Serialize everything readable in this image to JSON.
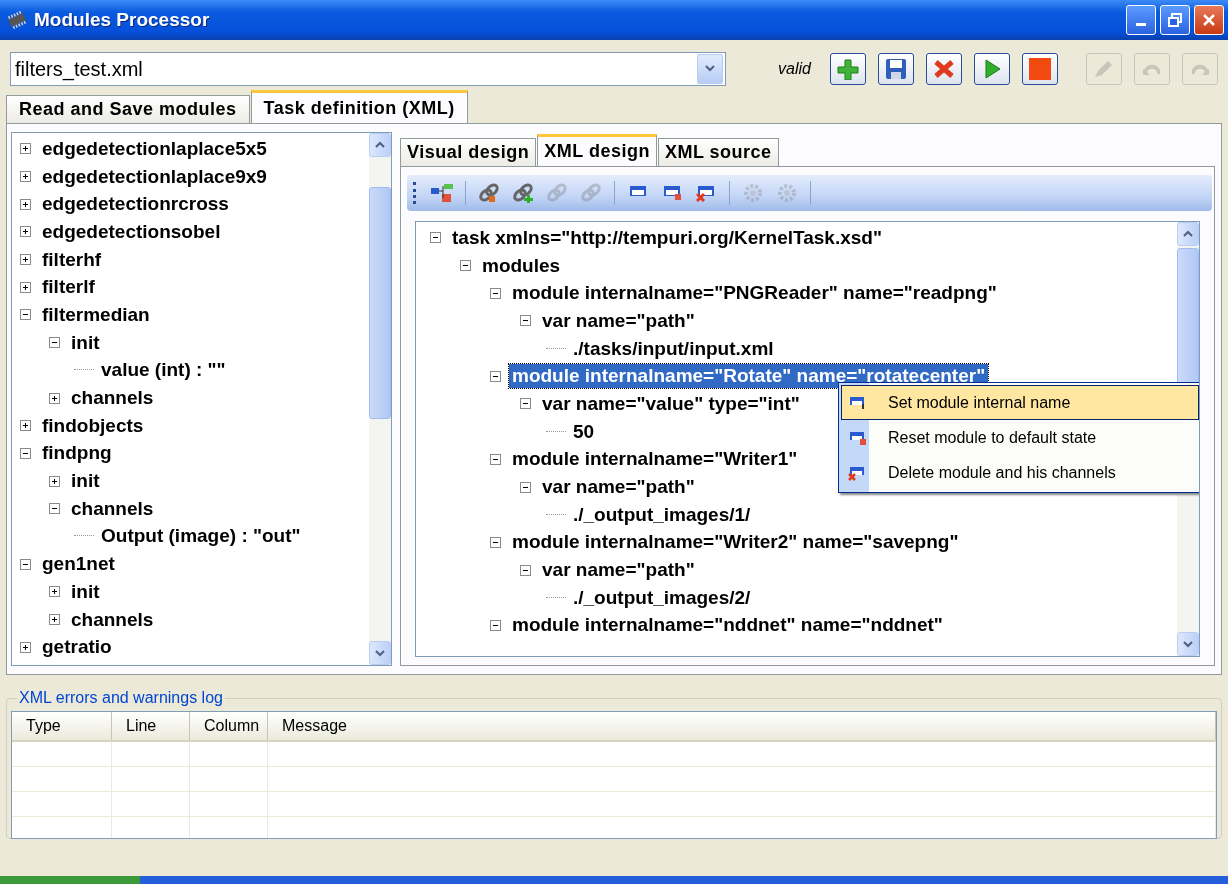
{
  "window": {
    "title": "Modules Processor"
  },
  "file_combo": {
    "value": "filters_test.xml"
  },
  "validation": "valid",
  "toolbar": [
    {
      "kind": "add",
      "disabled": false
    },
    {
      "kind": "save",
      "disabled": false
    },
    {
      "kind": "delete",
      "disabled": false
    },
    {
      "kind": "run",
      "disabled": false
    },
    {
      "kind": "stop",
      "disabled": false
    },
    {
      "kind": "edit",
      "disabled": true
    },
    {
      "kind": "undo",
      "disabled": true
    },
    {
      "kind": "redo",
      "disabled": true
    }
  ],
  "tabs": [
    {
      "label": "Read and Save modules",
      "selected": false
    },
    {
      "label": "Task definition (XML)",
      "selected": true
    }
  ],
  "module_tree": {
    "items": [
      {
        "label": "edgedetectionlaplace5x5",
        "expanded": false
      },
      {
        "label": "edgedetectionlaplace9x9",
        "expanded": false
      },
      {
        "label": "edgedetectionrcross",
        "expanded": false
      },
      {
        "label": "edgedetectionsobel",
        "expanded": false
      },
      {
        "label": "filterhf",
        "expanded": false
      },
      {
        "label": "filterlf",
        "expanded": false
      },
      {
        "label": "filtermedian",
        "expanded": true,
        "children": [
          {
            "label": "init",
            "expanded": true,
            "children": [
              {
                "label": "value (int) : \"\""
              }
            ]
          },
          {
            "label": "channels",
            "expanded": false
          }
        ]
      },
      {
        "label": "findobjects",
        "expanded": false
      },
      {
        "label": "findpng",
        "expanded": true,
        "children": [
          {
            "label": "init",
            "expanded": false
          },
          {
            "label": "channels",
            "expanded": true,
            "children": [
              {
                "label": "Output (image) : \"out\""
              }
            ]
          }
        ]
      },
      {
        "label": "gen1net",
        "expanded": true,
        "children": [
          {
            "label": "init",
            "expanded": false
          },
          {
            "label": "channels",
            "expanded": false
          }
        ]
      },
      {
        "label": "getratio",
        "expanded": false
      }
    ]
  },
  "sub_tabs": [
    {
      "label": "Visual design",
      "selected": false
    },
    {
      "label": "XML design",
      "selected": true
    },
    {
      "label": "XML source",
      "selected": false
    }
  ],
  "xml_toolbar": [
    {
      "kind": "tree",
      "disabled": false
    },
    {
      "kind": "link-edit",
      "disabled": false
    },
    {
      "kind": "link-add",
      "disabled": false
    },
    {
      "kind": "link",
      "disabled": true
    },
    {
      "kind": "link",
      "disabled": true
    },
    {
      "kind": "window",
      "disabled": false
    },
    {
      "kind": "window-reset",
      "disabled": false
    },
    {
      "kind": "window-delete",
      "disabled": false
    },
    {
      "kind": "gear",
      "disabled": true
    },
    {
      "kind": "gear",
      "disabled": true
    }
  ],
  "xml_tree": {
    "items": [
      {
        "label": "task xmlns=\"http://tempuri.org/KernelTask.xsd\"",
        "expanded": true,
        "selected": false,
        "children": [
          {
            "label": "modules",
            "expanded": true,
            "selected": false,
            "children": [
              {
                "label": "module internalname=\"PNGReader\" name=\"readpng\"",
                "expanded": true,
                "selected": false,
                "children": [
                  {
                    "label": "var name=\"path\"",
                    "expanded": true,
                    "selected": false,
                    "children": [
                      {
                        "label": "./tasks/input/input.xml",
                        "selected": false
                      }
                    ]
                  }
                ]
              },
              {
                "label": "module internalname=\"Rotate\" name=\"rotatecenter\"",
                "expanded": true,
                "selected": true,
                "children": [
                  {
                    "label": "var name=\"value\" type=\"int\"",
                    "expanded": true,
                    "selected": false,
                    "children": [
                      {
                        "label": "50",
                        "selected": false
                      }
                    ]
                  }
                ]
              },
              {
                "label": "module internalname=\"Writer1\"",
                "expanded": true,
                "selected": false,
                "children": [
                  {
                    "label": "var name=\"path\"",
                    "expanded": true,
                    "selected": false,
                    "children": [
                      {
                        "label": "./_output_images/1/",
                        "selected": false
                      }
                    ]
                  }
                ]
              },
              {
                "label": "module internalname=\"Writer2\" name=\"savepng\"",
                "expanded": true,
                "selected": false,
                "children": [
                  {
                    "label": "var name=\"path\"",
                    "expanded": true,
                    "selected": false,
                    "children": [
                      {
                        "label": "./_output_images/2/",
                        "selected": false
                      }
                    ]
                  }
                ]
              },
              {
                "label": "module internalname=\"nddnet\" name=\"nddnet\"",
                "expanded": true,
                "selected": false
              }
            ]
          }
        ]
      }
    ]
  },
  "context_menu": {
    "items": [
      {
        "label": "Set module internal name",
        "kind": "set",
        "selected": true
      },
      {
        "label": "Reset module to default state",
        "kind": "reset",
        "selected": false
      },
      {
        "label": "Delete module and his channels",
        "kind": "delete",
        "selected": false
      }
    ]
  },
  "log": {
    "title": "XML errors and warnings log",
    "columns": [
      "Type",
      "Line",
      "Column",
      "Message"
    ]
  }
}
